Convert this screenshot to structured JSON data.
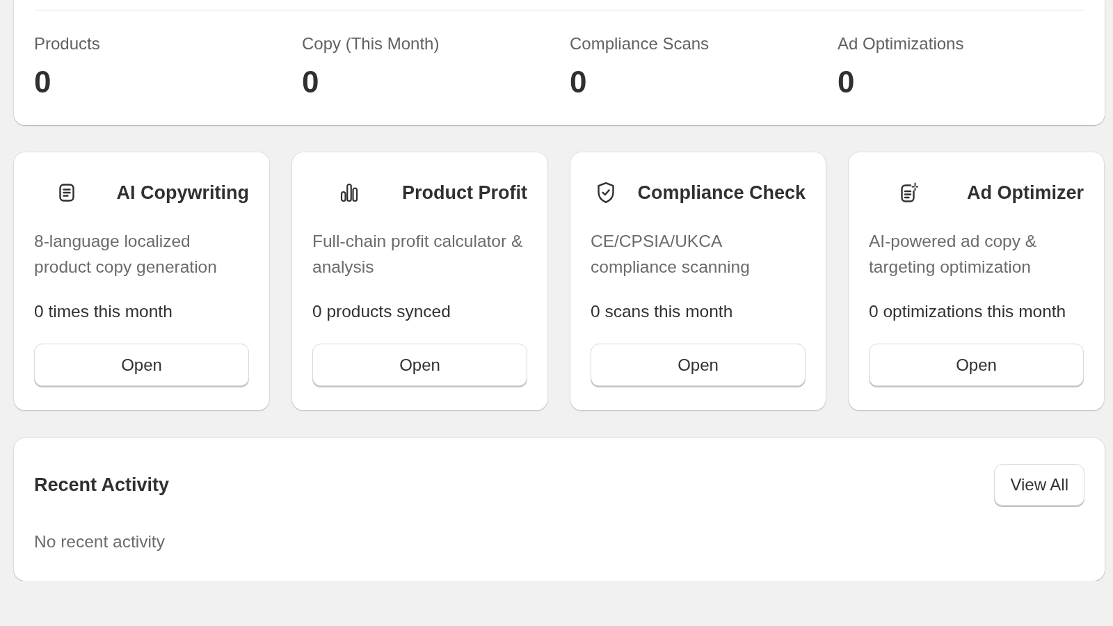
{
  "stats": [
    {
      "label": "Products",
      "value": "0"
    },
    {
      "label": "Copy (This Month)",
      "value": "0"
    },
    {
      "label": "Compliance Scans",
      "value": "0"
    },
    {
      "label": "Ad Optimizations",
      "value": "0"
    }
  ],
  "features": [
    {
      "kind": "copywriting",
      "title": "AI Copywriting",
      "description": "8-language localized product copy generation",
      "usage": "0 times this month",
      "button": "Open"
    },
    {
      "kind": "profit",
      "title": "Product Profit",
      "description": "Full-chain profit calculator & analysis",
      "usage": "0 products synced",
      "button": "Open"
    },
    {
      "kind": "compliance",
      "title": "Compliance Check",
      "description": "CE/CPSIA/UKCA compliance scanning",
      "usage": "0 scans this month",
      "button": "Open"
    },
    {
      "kind": "ads",
      "title": "Ad Optimizer",
      "description": "AI-powered ad copy & targeting optimization",
      "usage": "0 optimizations this month",
      "button": "Open"
    }
  ],
  "recent_activity": {
    "title": "Recent Activity",
    "button": "View All",
    "empty_text": "No recent activity"
  }
}
